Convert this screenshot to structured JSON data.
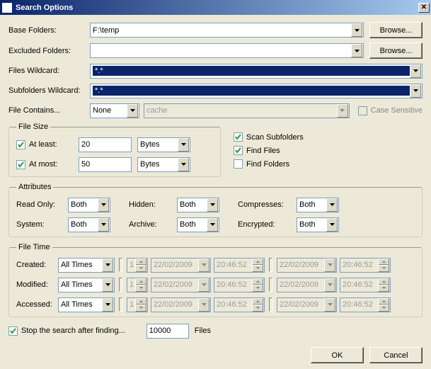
{
  "title": "Search Options",
  "labels": {
    "baseFolders": "Base Folders:",
    "excludedFolders": "Excluded Folders:",
    "filesWildcard": "Files Wildcard:",
    "subfoldersWildcard": "Subfolders Wildcard:",
    "fileContains": "File Contains...",
    "caseSensitive": "Case Sensitive",
    "browse": "Browse...",
    "fileSize": "File Size",
    "atLeast": "At least:",
    "atMost": "At most:",
    "scanSubfolders": "Scan Subfolders",
    "findFiles": "Find Files",
    "findFolders": "Find Folders",
    "attributes": "Attributes",
    "readOnly": "Read Only:",
    "hidden": "Hidden:",
    "system": "System:",
    "archive": "Archive:",
    "compresses": "Compresses:",
    "encrypted": "Encrypted:",
    "fileTime": "File Time",
    "created": "Created:",
    "modified": "Modified:",
    "accessed": "Accessed:",
    "stopAfter": "Stop the search after finding...",
    "files": "Files",
    "ok": "OK",
    "cancel": "Cancel"
  },
  "values": {
    "baseFolders": "F:\\temp",
    "excludedFolders": "",
    "filesWildcard": "*.*",
    "subfoldersWildcard": "*.*",
    "fileContainsMode": "None",
    "fileContainsText": "cache",
    "caseSensitive": false,
    "atLeastChecked": true,
    "atLeastVal": "20",
    "atLeastUnit": "Bytes",
    "atMostChecked": true,
    "atMostVal": "50",
    "atMostUnit": "Bytes",
    "scanSubfolders": true,
    "findFiles": true,
    "findFolders": false,
    "attrReadOnly": "Both",
    "attrHidden": "Both",
    "attrSystem": "Both",
    "attrArchive": "Both",
    "attrCompresses": "Both",
    "attrEncrypted": "Both",
    "timeCreated": "All Times",
    "timeModified": "All Times",
    "timeAccessed": "All Times",
    "ftNum": "1",
    "ftDate": "22/02/2009",
    "ftTime": "20:46:52",
    "stopAfterChecked": true,
    "stopAfterCount": "10000"
  }
}
